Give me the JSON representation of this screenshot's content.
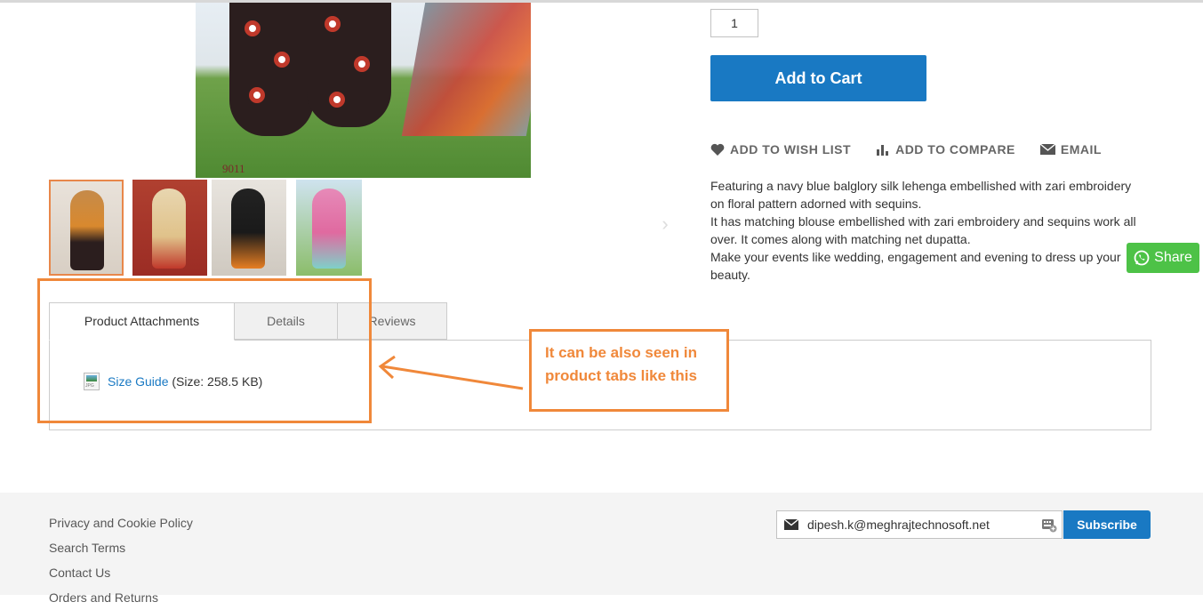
{
  "product": {
    "image_code": "9011",
    "qty_value": "1",
    "add_to_cart_label": "Add to Cart",
    "actions": {
      "wishlist": "ADD TO WISH LIST",
      "compare": "ADD TO COMPARE",
      "email": "EMAIL"
    },
    "description": [
      "Featuring a navy blue balglory silk lehenga embellished with zari embroidery on floral pattern adorned with sequins.",
      "It has matching blouse embellished with zari embroidery and sequins work all over. It comes along with matching net dupatta.",
      "Make your events like wedding, engagement and evening to dress up your beauty."
    ],
    "thumbnails_count": 4
  },
  "share": {
    "label": "Share"
  },
  "tabs": {
    "items": [
      {
        "label": "Product Attachments",
        "active": true
      },
      {
        "label": "Details",
        "active": false
      },
      {
        "label": "Reviews",
        "active": false
      }
    ],
    "attachment": {
      "link_text": "Size Guide",
      "size_text": "(Size: 258.5 KB)"
    }
  },
  "annotation": {
    "callout_line1": "It can be also seen in",
    "callout_line2": "product tabs like this"
  },
  "footer": {
    "links": [
      "Privacy and Cookie Policy",
      "Search Terms",
      "Contact Us",
      "Orders and Returns"
    ],
    "newsletter_value": "dipesh.k@meghrajtechnosoft.net",
    "subscribe_label": "Subscribe"
  },
  "colors": {
    "primary": "#1979c3",
    "annotation": "#f0883a",
    "whatsapp": "#4dc247"
  }
}
